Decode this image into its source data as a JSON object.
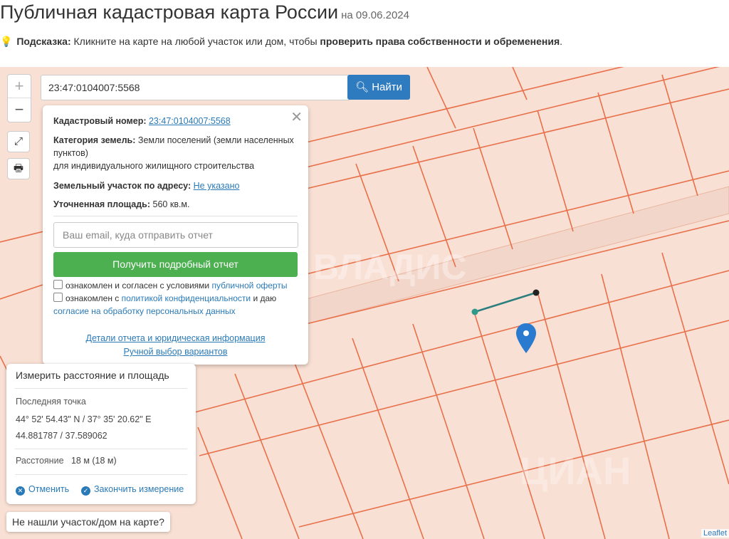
{
  "header": {
    "title": "Публичная кадастровая карта России",
    "date": "на 09.06.2024"
  },
  "hint": {
    "label": "Подсказка:",
    "text": "Кликните на карте на любой участок или дом, чтобы",
    "bold": "проверить права собственности и обременения",
    "end": "."
  },
  "map_controls": {
    "zoom_in": "+",
    "zoom_out": "−",
    "fullscreen": "⤢",
    "print": "🖶"
  },
  "search": {
    "value": "23:47:0104007:5568",
    "button_label": "Найти"
  },
  "popup": {
    "cadastral_label": "Кадастровый номер:",
    "cadastral_value": "23:47:0104007:5568",
    "category_label": "Категория земель:",
    "category_value": "Земли поселений (земли населенных пунктов)",
    "category_use": "для индивидуального жилищного строительства",
    "address_label": "Земельный участок по адресу:",
    "address_value": "Не указано",
    "area_label": "Уточненная площадь:",
    "area_value": "560 кв.м.",
    "email_placeholder": "Ваш email, куда отправить отчет",
    "report_button": "Получить подробный отчет",
    "checkbox1_text": "ознакомлен и согласен с условиями",
    "checkbox1_link": "публичной оферты",
    "checkbox2_text": "ознакомлен с",
    "checkbox2_link": "политикой конфиденциальности",
    "checkbox2_text2": "и даю",
    "checkbox2_link2": "согласие на обработку персональных данных",
    "details_link": "Детали отчета и юридическая информация",
    "manual_link": "Ручной выбор вариантов"
  },
  "measure": {
    "title": "Измерить расстояние и площадь",
    "last_point_label": "Последняя точка",
    "coords_dms": "44° 52' 54.43\" N / 37° 35' 20.62\" E",
    "coords_decimal": "44.881787 / 37.589062",
    "distance_label": "Расстояние",
    "distance_value": "18 м (18 м)",
    "cancel_label": "Отменить",
    "finish_label": "Закончить измерение"
  },
  "not_found_button": "Не нашли участок/дом на карте?",
  "attribution": "Leaflet",
  "watermarks": [
    "ВЛАДИС",
    "ЦИАН"
  ],
  "colors": {
    "map_bg": "#f9e0d4",
    "parcel_line": "#e8704a",
    "accent_blue": "#2f7bbf",
    "report_green": "#4caf50",
    "marker": "#2a7ad0"
  }
}
